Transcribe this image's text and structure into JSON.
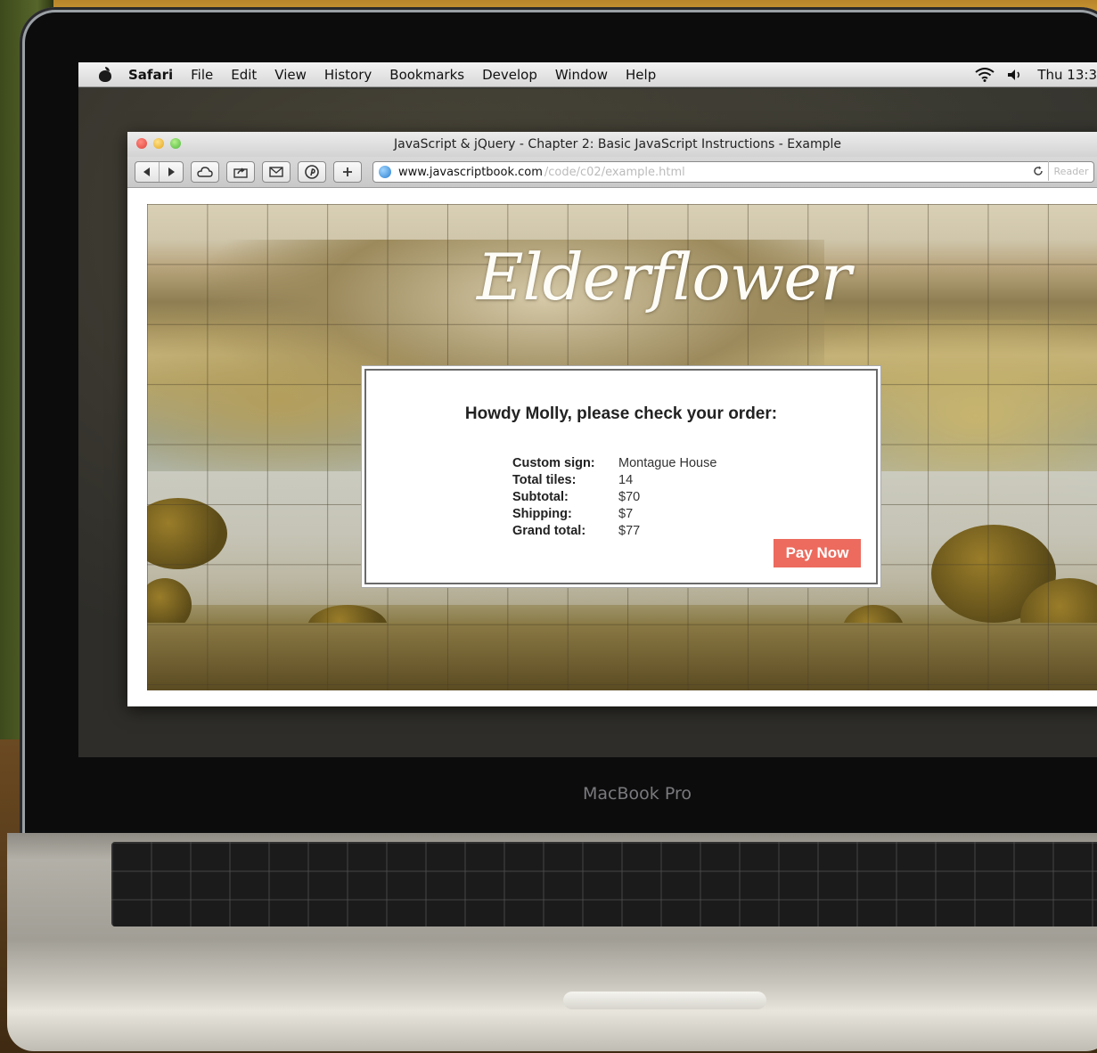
{
  "menubar": {
    "app": "Safari",
    "items": [
      "File",
      "Edit",
      "View",
      "History",
      "Bookmarks",
      "Develop",
      "Window",
      "Help"
    ],
    "clock": "Thu 13:3"
  },
  "window": {
    "title": "JavaScript & jQuery - Chapter 2: Basic JavaScript Instructions - Example"
  },
  "toolbar": {
    "url_host": "www.javascriptbook.com",
    "url_path": "/code/c02/example.html",
    "reader": "Reader"
  },
  "page": {
    "logo": "Elderflower",
    "order": {
      "heading": "Howdy Molly, please check your order:",
      "rows": [
        {
          "label": "Custom sign:",
          "value": "Montague House"
        },
        {
          "label": "Total tiles:",
          "value": "14"
        },
        {
          "label": "Subtotal:",
          "value": "$70"
        },
        {
          "label": "Shipping:",
          "value": "$7"
        },
        {
          "label": "Grand total:",
          "value": "$77"
        }
      ],
      "pay_button": "Pay Now"
    }
  },
  "device": {
    "bezel_label": "MacBook Pro"
  },
  "colors": {
    "pay_button": "#ec6b5e"
  }
}
